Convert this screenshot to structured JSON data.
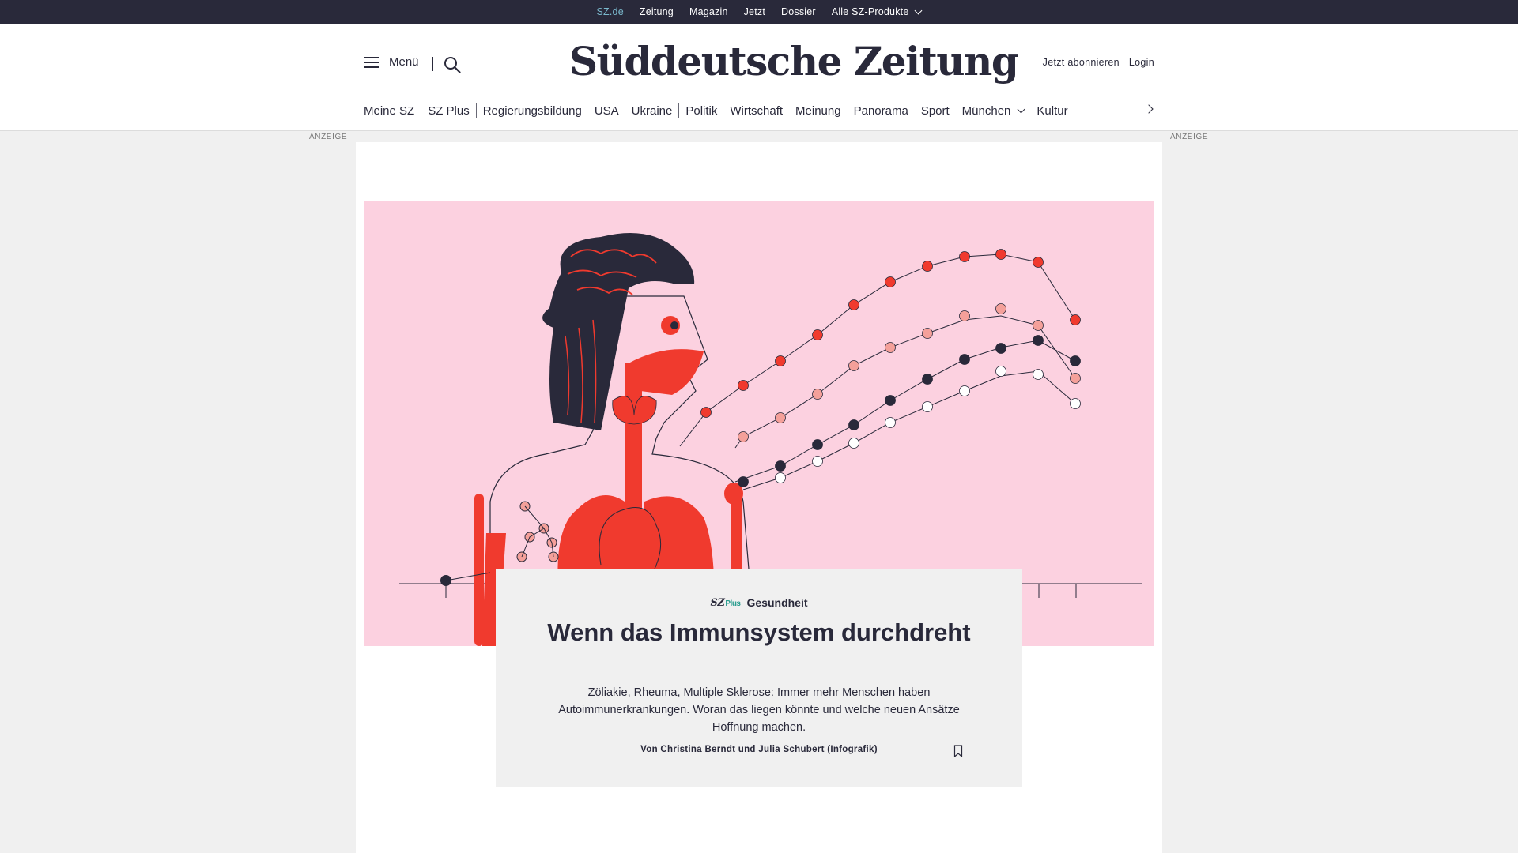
{
  "topbar": {
    "links": [
      "SZ.de",
      "Zeitung",
      "Magazin",
      "Jetzt",
      "Dossier",
      "Alle SZ-Produkte"
    ]
  },
  "header": {
    "menu_label": "Menü",
    "logo": "Süddeutsche Zeitung",
    "subscribe": "Jetzt abonnieren",
    "login": "Login"
  },
  "nav": {
    "items": [
      "Meine SZ",
      "SZ Plus",
      "Regierungsbildung",
      "USA",
      "Ukraine",
      "Politik",
      "Wirtschaft",
      "Meinung",
      "Panorama",
      "Sport",
      "München",
      "Kultur"
    ]
  },
  "ads": {
    "left": "ANZEIGE",
    "right": "ANZEIGE"
  },
  "article": {
    "brand": "SZ",
    "brand_plus": "Plus",
    "kicker": "Gesundheit",
    "headline": "Wenn das Immunsystem durchdreht",
    "teaser": "Zöliakie, Rheuma, Multiple Sklerose: Immer mehr Menschen haben Autoimmunerkrankungen. Woran das liegen könnte und welche neuen Ansätze Hoffnung machen.",
    "byline": "Von Christina Berndt und Julia Schubert (Infografik)"
  },
  "colors": {
    "dark": "#29293a",
    "red": "#f03a2e",
    "salmon": "#f4a09a",
    "pink_bg": "#fcd1e0",
    "accent_teal": "#7ab8cc"
  }
}
